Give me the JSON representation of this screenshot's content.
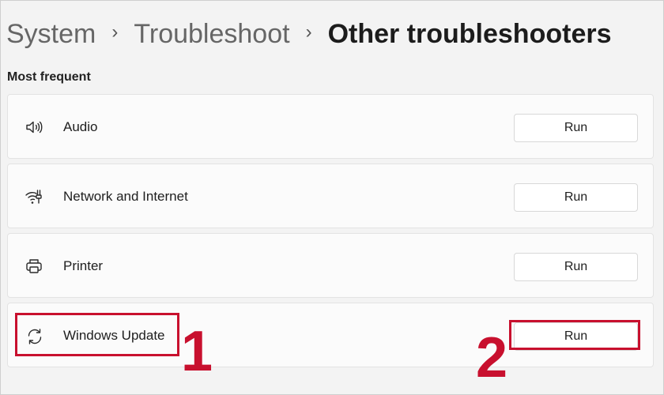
{
  "breadcrumb": {
    "items": [
      "System",
      "Troubleshoot",
      "Other troubleshooters"
    ],
    "separator": "›"
  },
  "section": {
    "label": "Most frequent"
  },
  "troubleshooters": [
    {
      "label": "Audio",
      "icon": "speaker-icon",
      "button": "Run"
    },
    {
      "label": "Network and Internet",
      "icon": "network-wifi-icon",
      "button": "Run"
    },
    {
      "label": "Printer",
      "icon": "printer-icon",
      "button": "Run"
    },
    {
      "label": "Windows Update",
      "icon": "sync-icon",
      "button": "Run"
    }
  ],
  "annotations": {
    "step1": "1",
    "step2": "2",
    "color": "#c8102e"
  }
}
